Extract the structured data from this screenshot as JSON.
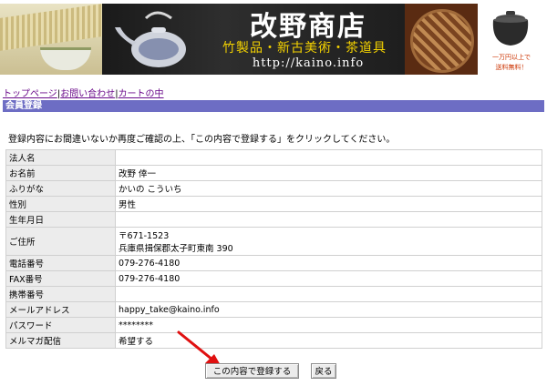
{
  "banner": {
    "title": "改野商店",
    "subtitle": "竹製品・新古美術・茶道具",
    "url": "http://kaino.info",
    "note_line1": "一万円以上で",
    "note_line2": "送料無料！"
  },
  "nav": {
    "top": "トップページ",
    "contact": "お問い合わせ",
    "cart": "カートの中",
    "separator": "|"
  },
  "section": {
    "title": "会員登録"
  },
  "instruction": "登録内容にお間違いないか再度ご確認の上、「この内容で登録する」をクリックしてください。",
  "form_rows": [
    {
      "label": "法人名",
      "value": ""
    },
    {
      "label": "お名前",
      "value": "改野 倖一"
    },
    {
      "label": "ふりがな",
      "value": "かいの こういち"
    },
    {
      "label": "性別",
      "value": "男性"
    },
    {
      "label": "生年月日",
      "value": ""
    },
    {
      "label": "ご住所",
      "value": "〒671-1523",
      "value2": "兵庫県揖保郡太子町東南 390"
    },
    {
      "label": "電話番号",
      "value": "079-276-4180"
    },
    {
      "label": "FAX番号",
      "value": "079-276-4180"
    },
    {
      "label": "携帯番号",
      "value": ""
    },
    {
      "label": "メールアドレス",
      "value": "happy_take@kaino.info"
    },
    {
      "label": "パスワード",
      "value": "********"
    },
    {
      "label": "メルマガ配信",
      "value": "希望する"
    }
  ],
  "buttons": {
    "submit": "この内容で登録する",
    "back": "戻る"
  },
  "colors": {
    "section_header_bg": "#6d6dc4",
    "nav_link": "#6a0a8a",
    "banner_subtitle": "#f4d200",
    "arrow": "#e01010"
  },
  "icons": {
    "arrow": "red-arrow-icon"
  }
}
